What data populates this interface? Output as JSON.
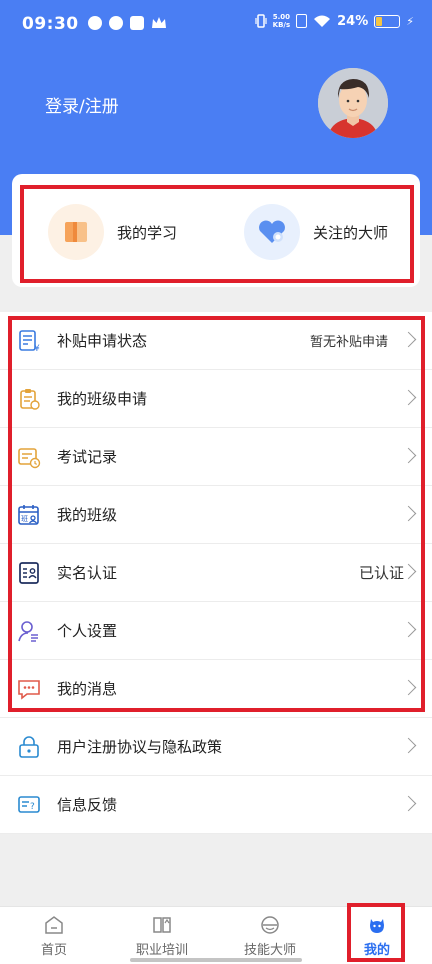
{
  "status_bar": {
    "time": "09:30",
    "net_speed_value": "5.00",
    "net_speed_unit": "KB/s",
    "battery": "24%"
  },
  "header": {
    "login_label": "登录/注册"
  },
  "quick_links": [
    {
      "label": "我的学习",
      "icon": "book-icon"
    },
    {
      "label": "关注的大师",
      "icon": "heart-icon"
    }
  ],
  "menu": [
    {
      "label": "补贴申请状态",
      "value": "暂无补贴申请",
      "icon": "subsidy-form-icon"
    },
    {
      "label": "我的班级申请",
      "value": "",
      "icon": "clipboard-icon"
    },
    {
      "label": "考试记录",
      "value": "",
      "icon": "exam-record-icon"
    },
    {
      "label": "我的班级",
      "value": "",
      "icon": "class-calendar-icon"
    },
    {
      "label": "实名认证",
      "value": "已认证",
      "icon": "id-card-icon"
    },
    {
      "label": "个人设置",
      "value": "",
      "icon": "person-settings-icon"
    },
    {
      "label": "我的消息",
      "value": "",
      "icon": "message-icon"
    },
    {
      "label": "用户注册协议与隐私政策",
      "value": "",
      "icon": "lock-icon"
    },
    {
      "label": "信息反馈",
      "value": "",
      "icon": "feedback-icon"
    }
  ],
  "bottom_nav": [
    {
      "label": "首页",
      "icon": "home-icon",
      "active": false
    },
    {
      "label": "职业培训",
      "icon": "training-book-icon",
      "active": false
    },
    {
      "label": "技能大师",
      "icon": "master-icon",
      "active": false
    },
    {
      "label": "我的",
      "icon": "mine-icon",
      "active": true
    }
  ],
  "colors": {
    "header_blue": "#4a7ef3",
    "highlight_red": "#e01f2b",
    "active_blue": "#2a6ef0"
  }
}
